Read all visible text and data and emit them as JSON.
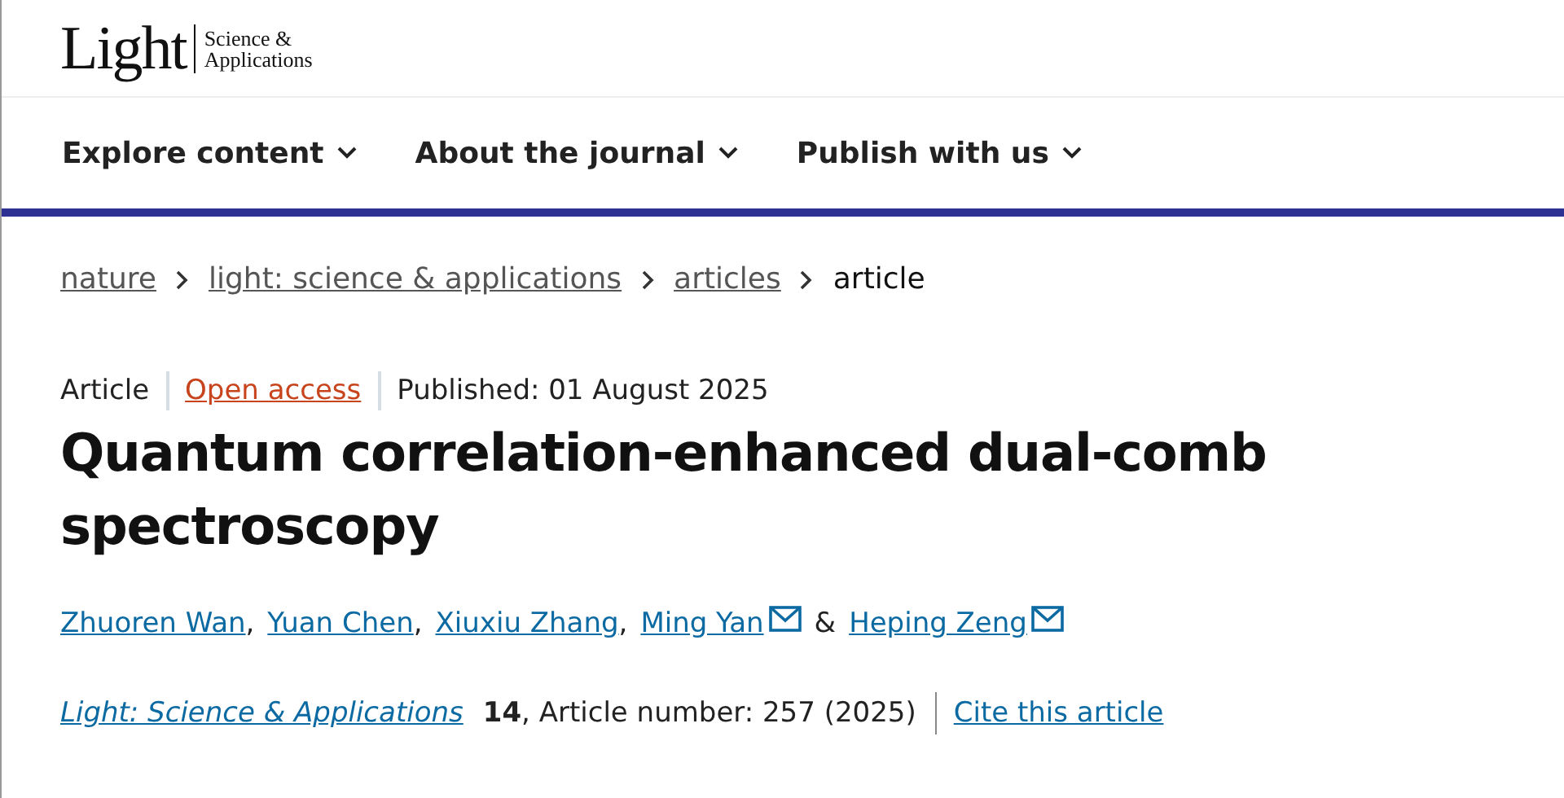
{
  "logo": {
    "wordmark": "Light",
    "subtitle_line_1": "Science &",
    "subtitle_line_2": "Applications"
  },
  "nav": [
    {
      "label": "Explore content"
    },
    {
      "label": "About the journal"
    },
    {
      "label": "Publish with us"
    }
  ],
  "breadcrumbs": [
    {
      "label": "nature",
      "kind": "link"
    },
    {
      "label": "light: science & applications",
      "kind": "link"
    },
    {
      "label": "articles",
      "kind": "link"
    },
    {
      "label": "article",
      "kind": "current"
    }
  ],
  "meta": {
    "type": "Article",
    "access": "Open access",
    "published": "Published: 01 August 2025"
  },
  "title": "Quantum correlation-enhanced dual-comb spectroscopy",
  "authors": [
    {
      "name": "Zhuoren Wan",
      "email": false,
      "separator": ","
    },
    {
      "name": "Yuan Chen",
      "email": false,
      "separator": ","
    },
    {
      "name": "Xiuxiu Zhang",
      "email": false,
      "separator": ","
    },
    {
      "name": "Ming Yan",
      "email": true,
      "separator": "&"
    },
    {
      "name": "Heping Zeng",
      "email": true
    }
  ],
  "citation": {
    "journal": "Light: Science & Applications",
    "volume": "14",
    "details": ", Article number: 257 (2025)",
    "cite_link": "Cite this article"
  }
}
